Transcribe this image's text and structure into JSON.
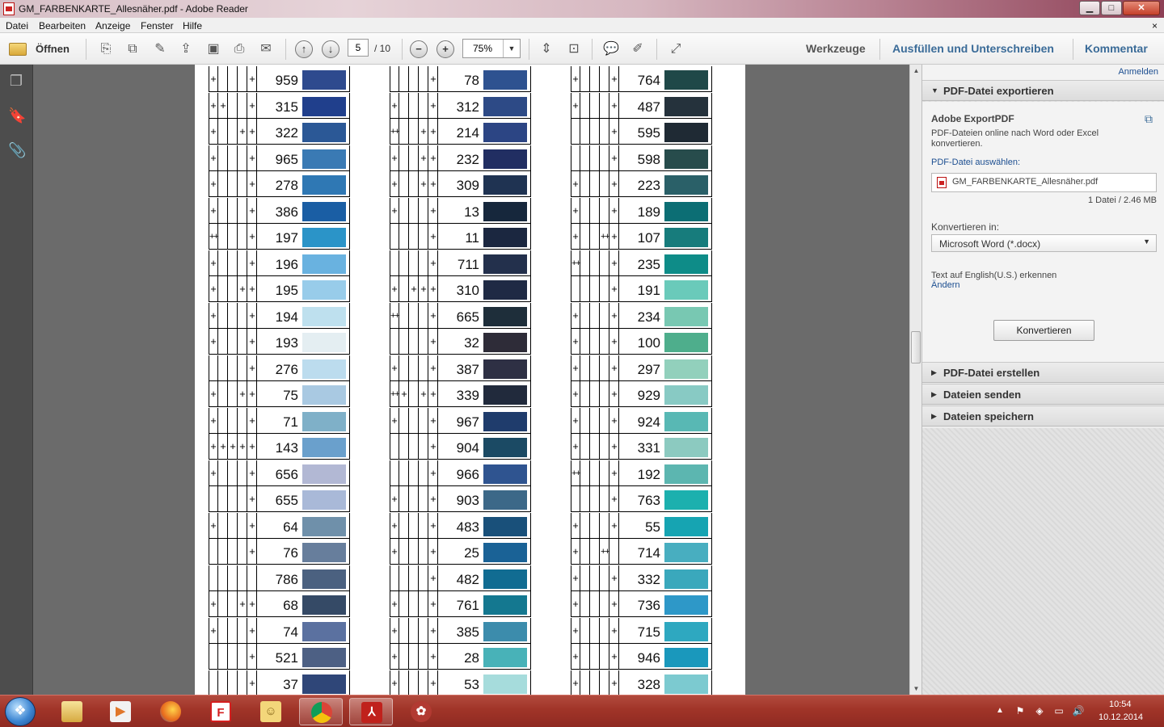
{
  "window": {
    "title": "GM_FARBENKARTE_Allesnäher.pdf - Adobe Reader",
    "minimize": "▁",
    "maximize": "□",
    "close": "✕"
  },
  "menu": {
    "items": [
      "Datei",
      "Bearbeiten",
      "Anzeige",
      "Fenster",
      "Hilfe"
    ],
    "close_doc": "×"
  },
  "toolbar": {
    "open_label": "Öffnen",
    "page_current": "5",
    "page_total": "/ 10",
    "zoom": "75%",
    "werkzeuge": "Werkzeuge",
    "ausfuellen": "Ausfüllen und Unterschreiben",
    "kommentar": "Kommentar"
  },
  "right_pane": {
    "sign_in": "Anmelden",
    "export_header": "PDF-Datei exportieren",
    "export_title": "Adobe ExportPDF",
    "export_desc": "PDF-Dateien online nach Word oder Excel konvertieren.",
    "select_label": "PDF-Datei auswählen:",
    "file_name": "GM_FARBENKARTE_Allesnäher.pdf",
    "file_count": "1 Datei / 2.46 MB",
    "convert_label": "Konvertieren in:",
    "convert_value": "Microsoft Word (*.docx)",
    "language_text": "Text auf English(U.S.) erkennen",
    "change_link": "Ändern",
    "convert_button": "Konvertieren",
    "sections": [
      "PDF-Datei erstellen",
      "Dateien senden",
      "Dateien speichern"
    ]
  },
  "color_chart": {
    "columns": [
      {
        "rows": [
          {
            "num": "959",
            "marks": [
              1,
              0,
              0,
              0,
              1
            ],
            "color": "#2e4a8e"
          },
          {
            "num": "315",
            "marks": [
              1,
              1,
              0,
              0,
              1
            ],
            "color": "#203f8c"
          },
          {
            "num": "322",
            "marks": [
              1,
              0,
              0,
              1,
              1
            ],
            "color": "#2b5896"
          },
          {
            "num": "965",
            "marks": [
              1,
              0,
              0,
              0,
              1
            ],
            "color": "#3a7ab4"
          },
          {
            "num": "278",
            "marks": [
              1,
              0,
              0,
              0,
              1
            ],
            "color": "#2f78b4"
          },
          {
            "num": "386",
            "marks": [
              1,
              0,
              0,
              0,
              1
            ],
            "color": "#1a5ea4"
          },
          {
            "num": "197",
            "marks": [
              2,
              0,
              0,
              0,
              1
            ],
            "color": "#2b94c8"
          },
          {
            "num": "196",
            "marks": [
              1,
              0,
              0,
              0,
              1
            ],
            "color": "#69b2e0"
          },
          {
            "num": "195",
            "marks": [
              1,
              0,
              0,
              1,
              1
            ],
            "color": "#98ccea"
          },
          {
            "num": "194",
            "marks": [
              1,
              0,
              0,
              0,
              1
            ],
            "color": "#bee0ee"
          },
          {
            "num": "193",
            "marks": [
              1,
              0,
              0,
              0,
              1
            ],
            "color": "#e4eef2"
          },
          {
            "num": "276",
            "marks": [
              0,
              0,
              0,
              0,
              1
            ],
            "color": "#bcdcee"
          },
          {
            "num": "75",
            "marks": [
              1,
              0,
              0,
              1,
              1
            ],
            "color": "#a9c9e2"
          },
          {
            "num": "71",
            "marks": [
              1,
              0,
              0,
              0,
              1
            ],
            "color": "#7fb0c8"
          },
          {
            "num": "143",
            "marks": [
              1,
              1,
              1,
              1,
              1
            ],
            "color": "#6aa0cc"
          },
          {
            "num": "656",
            "marks": [
              1,
              0,
              0,
              0,
              1
            ],
            "color": "#b2b8d4"
          },
          {
            "num": "655",
            "marks": [
              0,
              0,
              0,
              0,
              1
            ],
            "color": "#a9b9d8"
          },
          {
            "num": "64",
            "marks": [
              1,
              0,
              0,
              0,
              1
            ],
            "color": "#6f90aa"
          },
          {
            "num": "76",
            "marks": [
              0,
              0,
              0,
              0,
              1
            ],
            "color": "#677e9c"
          },
          {
            "num": "786",
            "marks": [
              0,
              0,
              0,
              0,
              0
            ],
            "color": "#4b6180"
          },
          {
            "num": "68",
            "marks": [
              1,
              0,
              0,
              1,
              1
            ],
            "color": "#354a66"
          },
          {
            "num": "74",
            "marks": [
              1,
              0,
              0,
              0,
              1
            ],
            "color": "#5b71a0"
          },
          {
            "num": "521",
            "marks": [
              0,
              0,
              0,
              0,
              1
            ],
            "color": "#4d6084"
          },
          {
            "num": "37",
            "marks": [
              0,
              0,
              0,
              0,
              1
            ],
            "color": "#2f4678"
          }
        ]
      },
      {
        "rows": [
          {
            "num": "78",
            "marks": [
              0,
              0,
              0,
              0,
              1
            ],
            "color": "#2e5290"
          },
          {
            "num": "312",
            "marks": [
              1,
              0,
              0,
              0,
              1
            ],
            "color": "#2d4a86"
          },
          {
            "num": "214",
            "marks": [
              2,
              0,
              0,
              1,
              1
            ],
            "color": "#2c4584"
          },
          {
            "num": "232",
            "marks": [
              1,
              0,
              0,
              1,
              1
            ],
            "color": "#212e62"
          },
          {
            "num": "309",
            "marks": [
              1,
              0,
              0,
              1,
              1
            ],
            "color": "#1f3352"
          },
          {
            "num": "13",
            "marks": [
              1,
              0,
              0,
              0,
              1
            ],
            "color": "#16273c"
          },
          {
            "num": "11",
            "marks": [
              0,
              0,
              0,
              0,
              1
            ],
            "color": "#1b2740"
          },
          {
            "num": "711",
            "marks": [
              0,
              0,
              0,
              0,
              1
            ],
            "color": "#23304c"
          },
          {
            "num": "310",
            "marks": [
              1,
              0,
              1,
              1,
              1
            ],
            "color": "#1f2a44"
          },
          {
            "num": "665",
            "marks": [
              2,
              0,
              0,
              0,
              1
            ],
            "color": "#1e2e3a"
          },
          {
            "num": "32",
            "marks": [
              0,
              0,
              0,
              0,
              1
            ],
            "color": "#2e2c38"
          },
          {
            "num": "387",
            "marks": [
              1,
              0,
              0,
              0,
              1
            ],
            "color": "#2e3044"
          },
          {
            "num": "339",
            "marks": [
              2,
              1,
              0,
              1,
              1
            ],
            "color": "#212a3c"
          },
          {
            "num": "967",
            "marks": [
              1,
              0,
              0,
              0,
              1
            ],
            "color": "#1f3c6c"
          },
          {
            "num": "904",
            "marks": [
              0,
              0,
              0,
              0,
              1
            ],
            "color": "#1b4a64"
          },
          {
            "num": "966",
            "marks": [
              0,
              0,
              0,
              0,
              1
            ],
            "color": "#2f5490"
          },
          {
            "num": "903",
            "marks": [
              1,
              0,
              0,
              0,
              1
            ],
            "color": "#3c6888"
          },
          {
            "num": "483",
            "marks": [
              1,
              0,
              0,
              0,
              1
            ],
            "color": "#19507a"
          },
          {
            "num": "25",
            "marks": [
              1,
              0,
              0,
              0,
              1
            ],
            "color": "#1a6296"
          },
          {
            "num": "482",
            "marks": [
              0,
              0,
              0,
              0,
              1
            ],
            "color": "#116c92"
          },
          {
            "num": "761",
            "marks": [
              1,
              0,
              0,
              0,
              1
            ],
            "color": "#147890"
          },
          {
            "num": "385",
            "marks": [
              1,
              0,
              0,
              0,
              1
            ],
            "color": "#3c8cac"
          },
          {
            "num": "28",
            "marks": [
              1,
              0,
              0,
              0,
              1
            ],
            "color": "#48b2b8"
          },
          {
            "num": "53",
            "marks": [
              1,
              0,
              0,
              0,
              1
            ],
            "color": "#a6dcdc"
          }
        ]
      },
      {
        "rows": [
          {
            "num": "764",
            "marks": [
              1,
              0,
              0,
              0,
              1
            ],
            "color": "#1f4848"
          },
          {
            "num": "487",
            "marks": [
              1,
              0,
              0,
              0,
              1
            ],
            "color": "#25323c"
          },
          {
            "num": "595",
            "marks": [
              0,
              0,
              0,
              0,
              1
            ],
            "color": "#1f2a34"
          },
          {
            "num": "598",
            "marks": [
              0,
              0,
              0,
              0,
              1
            ],
            "color": "#274c4c"
          },
          {
            "num": "223",
            "marks": [
              1,
              0,
              0,
              0,
              1
            ],
            "color": "#2a6068"
          },
          {
            "num": "189",
            "marks": [
              1,
              0,
              0,
              0,
              1
            ],
            "color": "#0c6e74"
          },
          {
            "num": "107",
            "marks": [
              1,
              0,
              0,
              2,
              1
            ],
            "color": "#177c7c"
          },
          {
            "num": "235",
            "marks": [
              2,
              0,
              0,
              0,
              1
            ],
            "color": "#0e8c88"
          },
          {
            "num": "191",
            "marks": [
              0,
              0,
              0,
              0,
              1
            ],
            "color": "#6acaba"
          },
          {
            "num": "234",
            "marks": [
              1,
              0,
              0,
              0,
              1
            ],
            "color": "#78c8b2"
          },
          {
            "num": "100",
            "marks": [
              1,
              0,
              0,
              0,
              1
            ],
            "color": "#4eae8c"
          },
          {
            "num": "297",
            "marks": [
              1,
              0,
              0,
              0,
              1
            ],
            "color": "#92d0bc"
          },
          {
            "num": "929",
            "marks": [
              1,
              0,
              0,
              0,
              1
            ],
            "color": "#88cac4"
          },
          {
            "num": "924",
            "marks": [
              1,
              0,
              0,
              0,
              1
            ],
            "color": "#58b8b4"
          },
          {
            "num": "331",
            "marks": [
              1,
              0,
              0,
              0,
              1
            ],
            "color": "#8ccac0"
          },
          {
            "num": "192",
            "marks": [
              2,
              0,
              0,
              0,
              1
            ],
            "color": "#5cb6b0"
          },
          {
            "num": "763",
            "marks": [
              0,
              0,
              0,
              0,
              1
            ],
            "color": "#1cb0ae"
          },
          {
            "num": "55",
            "marks": [
              1,
              0,
              0,
              0,
              1
            ],
            "color": "#16a4b2"
          },
          {
            "num": "714",
            "marks": [
              1,
              0,
              0,
              2,
              0
            ],
            "color": "#48aec0"
          },
          {
            "num": "332",
            "marks": [
              1,
              0,
              0,
              0,
              1
            ],
            "color": "#3aa8bc"
          },
          {
            "num": "736",
            "marks": [
              1,
              0,
              0,
              0,
              1
            ],
            "color": "#2e98c8"
          },
          {
            "num": "715",
            "marks": [
              1,
              0,
              0,
              0,
              1
            ],
            "color": "#2ea8c0"
          },
          {
            "num": "946",
            "marks": [
              1,
              0,
              0,
              0,
              1
            ],
            "color": "#1a98bc"
          },
          {
            "num": "328",
            "marks": [
              1,
              0,
              0,
              0,
              1
            ],
            "color": "#7ccad0"
          }
        ]
      }
    ]
  },
  "taskbar": {
    "start": "❖",
    "clock_time": "10:54",
    "clock_date": "10.12.2014"
  }
}
